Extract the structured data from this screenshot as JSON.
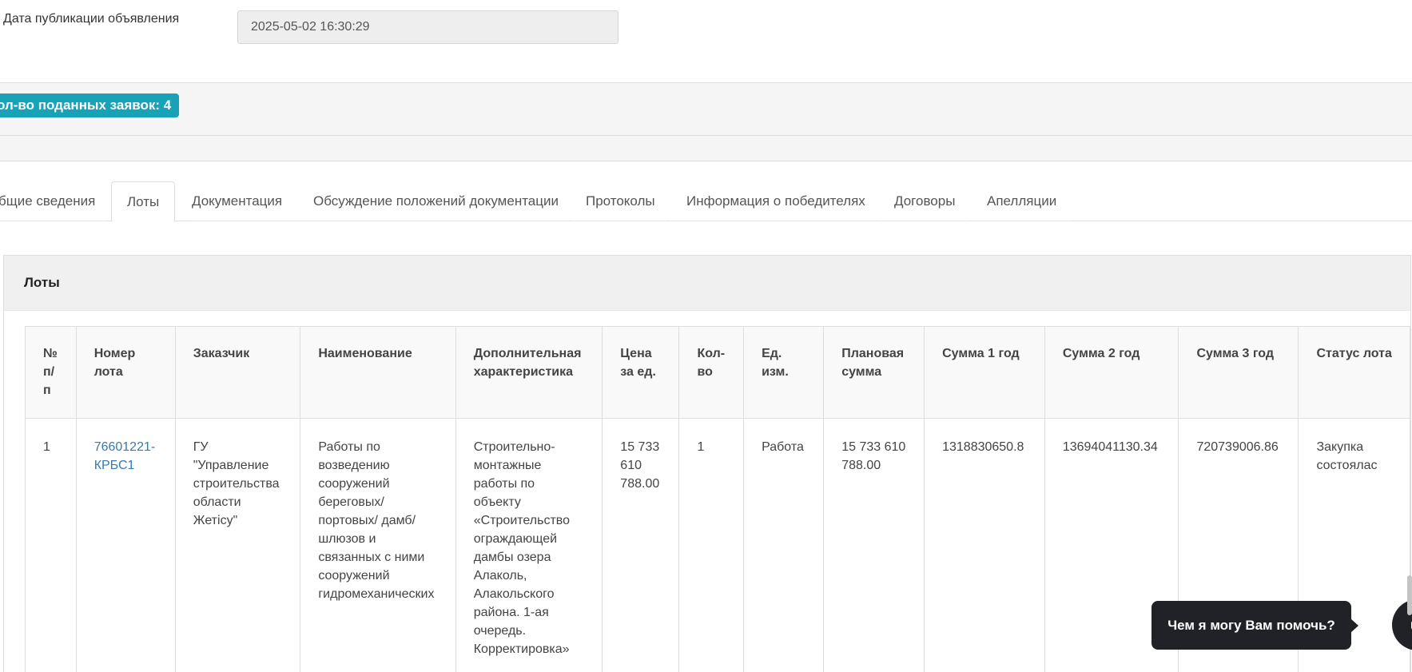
{
  "publication": {
    "label": "Дата публикации объявления",
    "value": "2025-05-02 16:30:29"
  },
  "applications_badge": "ол-во поданных заявок: 4",
  "tabs": [
    {
      "label": "бщие сведения"
    },
    {
      "label": "Лоты"
    },
    {
      "label": "Документация"
    },
    {
      "label": "Обсуждение положений документации"
    },
    {
      "label": "Протоколы"
    },
    {
      "label": "Информация о победителях"
    },
    {
      "label": "Договоры"
    },
    {
      "label": "Апелляции"
    }
  ],
  "panel": {
    "title": "Лоты"
  },
  "table": {
    "headers": [
      "№ п/ п",
      "Номер лота",
      "Заказчик",
      "Наименование",
      "Дополнительная характеристика",
      "Цена за ед.",
      "Кол-во",
      "Ед. изм.",
      "Плановая сумма",
      "Сумма 1 год",
      "Сумма 2 год",
      "Сумма 3 год",
      "Статус лота"
    ],
    "row": {
      "num": "1",
      "lot_number": "76601221-КРБС1",
      "customer": "ГУ \"Управление строительства области Жетісу\"",
      "name": "Работы по возведению сооружений береговых/ портовых/ дамб/ шлюзов и связанных с ними сооружений гидромеханических",
      "extra": "Строительно-монтажные работы по объекту «Строительство ограждающей дамбы озера Алаколь, Алакольского района. 1-ая очередь. Корректировка»",
      "unit_price": "15 733 610 788.00",
      "qty": "1",
      "unit": "Работа",
      "planned_sum": "15 733 610 788.00",
      "sum1": "1318830650.8",
      "sum2": "13694041130.34",
      "sum3": "720739006.86",
      "status": "Закупка состоялас"
    }
  },
  "chat": {
    "prompt": "Чем я могу Вам помочь?"
  }
}
